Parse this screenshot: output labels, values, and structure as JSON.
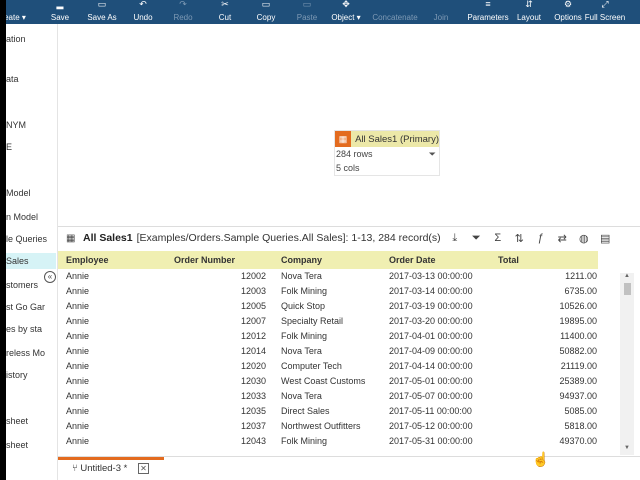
{
  "toolbar": {
    "buttons": [
      {
        "label": "eate ▾",
        "icon": "create-icon",
        "glyph": "",
        "enabled": true
      },
      {
        "label": "Save",
        "icon": "save-icon",
        "glyph": "▂",
        "enabled": true
      },
      {
        "label": "Save As",
        "icon": "save-as-icon",
        "glyph": "▭",
        "enabled": true
      },
      {
        "label": "Undo",
        "icon": "undo-icon",
        "glyph": "↶",
        "enabled": true
      },
      {
        "label": "Redo",
        "icon": "redo-icon",
        "glyph": "↷",
        "enabled": false
      },
      {
        "label": "Cut",
        "icon": "cut-icon",
        "glyph": "✂",
        "enabled": true
      },
      {
        "label": "Copy",
        "icon": "copy-icon",
        "glyph": "▭",
        "enabled": true
      },
      {
        "label": "Paste",
        "icon": "paste-icon",
        "glyph": "▭",
        "enabled": false
      },
      {
        "label": "Object ▾",
        "icon": "object-icon",
        "glyph": "✥",
        "enabled": true
      },
      {
        "label": "Concatenate",
        "icon": "concatenate-icon",
        "glyph": "",
        "enabled": false
      },
      {
        "label": "Join",
        "icon": "join-icon",
        "glyph": "",
        "enabled": false
      },
      {
        "label": "Parameters",
        "icon": "parameters-icon",
        "glyph": "≡",
        "enabled": true
      },
      {
        "label": "Layout",
        "icon": "layout-icon",
        "glyph": "⇵",
        "enabled": true
      },
      {
        "label": "Options",
        "icon": "options-gear-icon",
        "glyph": "⚙",
        "enabled": true
      },
      {
        "label": "Full Screen",
        "icon": "full-screen-icon",
        "glyph": "⤢",
        "enabled": true
      }
    ]
  },
  "sidebar": {
    "collapse_glyph": "«",
    "items": [
      {
        "label": "ation",
        "active": false
      },
      {
        "label": "ata",
        "active": false
      },
      {
        "label": "NYM",
        "active": false
      },
      {
        "label": "E",
        "active": false
      },
      {
        "label": "Model",
        "active": false
      },
      {
        "label": "n Model",
        "active": false
      },
      {
        "label": "le Queries",
        "active": false
      },
      {
        "label": "Sales",
        "active": true
      },
      {
        "label": "stomers",
        "active": false
      },
      {
        "label": "st Go Gar",
        "active": false
      },
      {
        "label": "es by sta",
        "active": false
      },
      {
        "label": "reless Mo",
        "active": false
      },
      {
        "label": "istory",
        "active": false
      },
      {
        "label": "sheet",
        "active": false
      },
      {
        "label": "sheet",
        "active": false
      }
    ]
  },
  "node": {
    "icon_glyph": "▦",
    "title": "All Sales1 (Primary)",
    "rows_text": "284 rows",
    "cols_text": "5 cols",
    "filter_glyph": "⏷"
  },
  "panel": {
    "name": "All Sales1",
    "path": "[Examples/Orders.Sample Queries.All Sales]: 1-13, 284 record(s)",
    "table_glyph": "▦",
    "tools": [
      {
        "icon": "download-icon",
        "glyph": "⤓"
      },
      {
        "icon": "filter-icon",
        "glyph": "⏷"
      },
      {
        "icon": "sum-icon",
        "glyph": "Σ"
      },
      {
        "icon": "sort-icon",
        "glyph": "⇅"
      },
      {
        "icon": "formula-icon",
        "glyph": "ƒ"
      },
      {
        "icon": "swap-icon",
        "glyph": "⇄"
      },
      {
        "icon": "chart-icon",
        "glyph": "◍"
      },
      {
        "icon": "columns-icon",
        "glyph": "▤"
      }
    ],
    "columns": [
      "Employee",
      "Order Number",
      "Company",
      "Order Date",
      "Total"
    ],
    "rows": [
      [
        "Annie",
        "12002",
        "Nova Tera",
        "2017-03-13 00:00:00",
        "1211.00"
      ],
      [
        "Annie",
        "12003",
        "Folk Mining",
        "2017-03-14 00:00:00",
        "6735.00"
      ],
      [
        "Annie",
        "12005",
        "Quick Stop",
        "2017-03-19 00:00:00",
        "10526.00"
      ],
      [
        "Annie",
        "12007",
        "Specialty Retail",
        "2017-03-20 00:00:00",
        "19895.00"
      ],
      [
        "Annie",
        "12012",
        "Folk Mining",
        "2017-04-01 00:00:00",
        "11400.00"
      ],
      [
        "Annie",
        "12014",
        "Nova Tera",
        "2017-04-09 00:00:00",
        "50882.00"
      ],
      [
        "Annie",
        "12020",
        "Computer Tech",
        "2017-04-14 00:00:00",
        "21119.00"
      ],
      [
        "Annie",
        "12030",
        "West Coast Customs",
        "2017-05-01 00:00:00",
        "25389.00"
      ],
      [
        "Annie",
        "12033",
        "Nova Tera",
        "2017-05-07 00:00:00",
        "94937.00"
      ],
      [
        "Annie",
        "12035",
        "Direct Sales",
        "2017-05-11 00:00:00",
        "5085.00"
      ],
      [
        "Annie",
        "12037",
        "Northwest Outfitters",
        "2017-05-12 00:00:00",
        "5818.00"
      ],
      [
        "Annie",
        "12043",
        "Folk Mining",
        "2017-05-31 00:00:00",
        "49370.00"
      ]
    ]
  },
  "tabbar": {
    "tab_label": "Untitled-3 *",
    "tab_glyph": "⑂",
    "close_glyph": "✕"
  },
  "colors": {
    "toolbar": "#1f4f7a",
    "accent": "#e36b1f",
    "grid_header": "#f0efb2",
    "node_header": "#ece8a8",
    "sidebar_active": "#d6f3f6"
  }
}
